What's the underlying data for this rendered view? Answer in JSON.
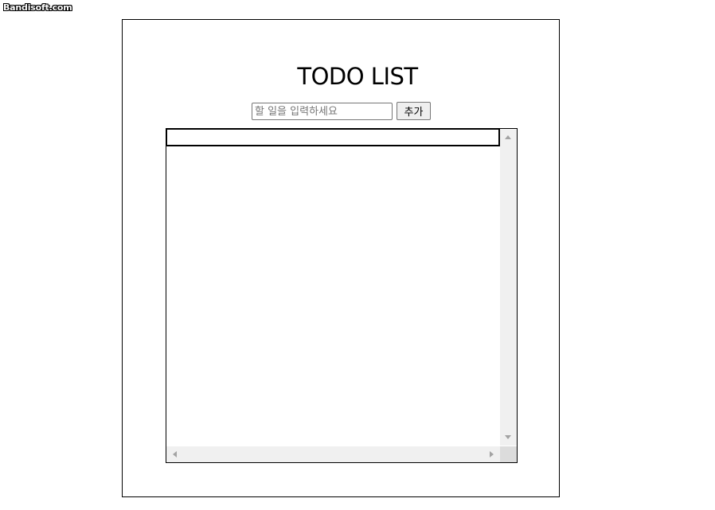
{
  "watermark": {
    "text": "Bandisoft.com"
  },
  "app": {
    "title": "TODO LIST"
  },
  "todo_form": {
    "input_value": "",
    "input_placeholder": "할 일을 입력하세요",
    "add_button_label": "추가"
  },
  "todo_list": {
    "items": [],
    "has_vertical_scrollbar": true,
    "has_horizontal_scrollbar": true
  },
  "icons": {
    "scroll_up": "triangle-up-icon",
    "scroll_down": "triangle-down-icon",
    "scroll_left": "triangle-left-icon",
    "scroll_right": "triangle-right-icon"
  }
}
